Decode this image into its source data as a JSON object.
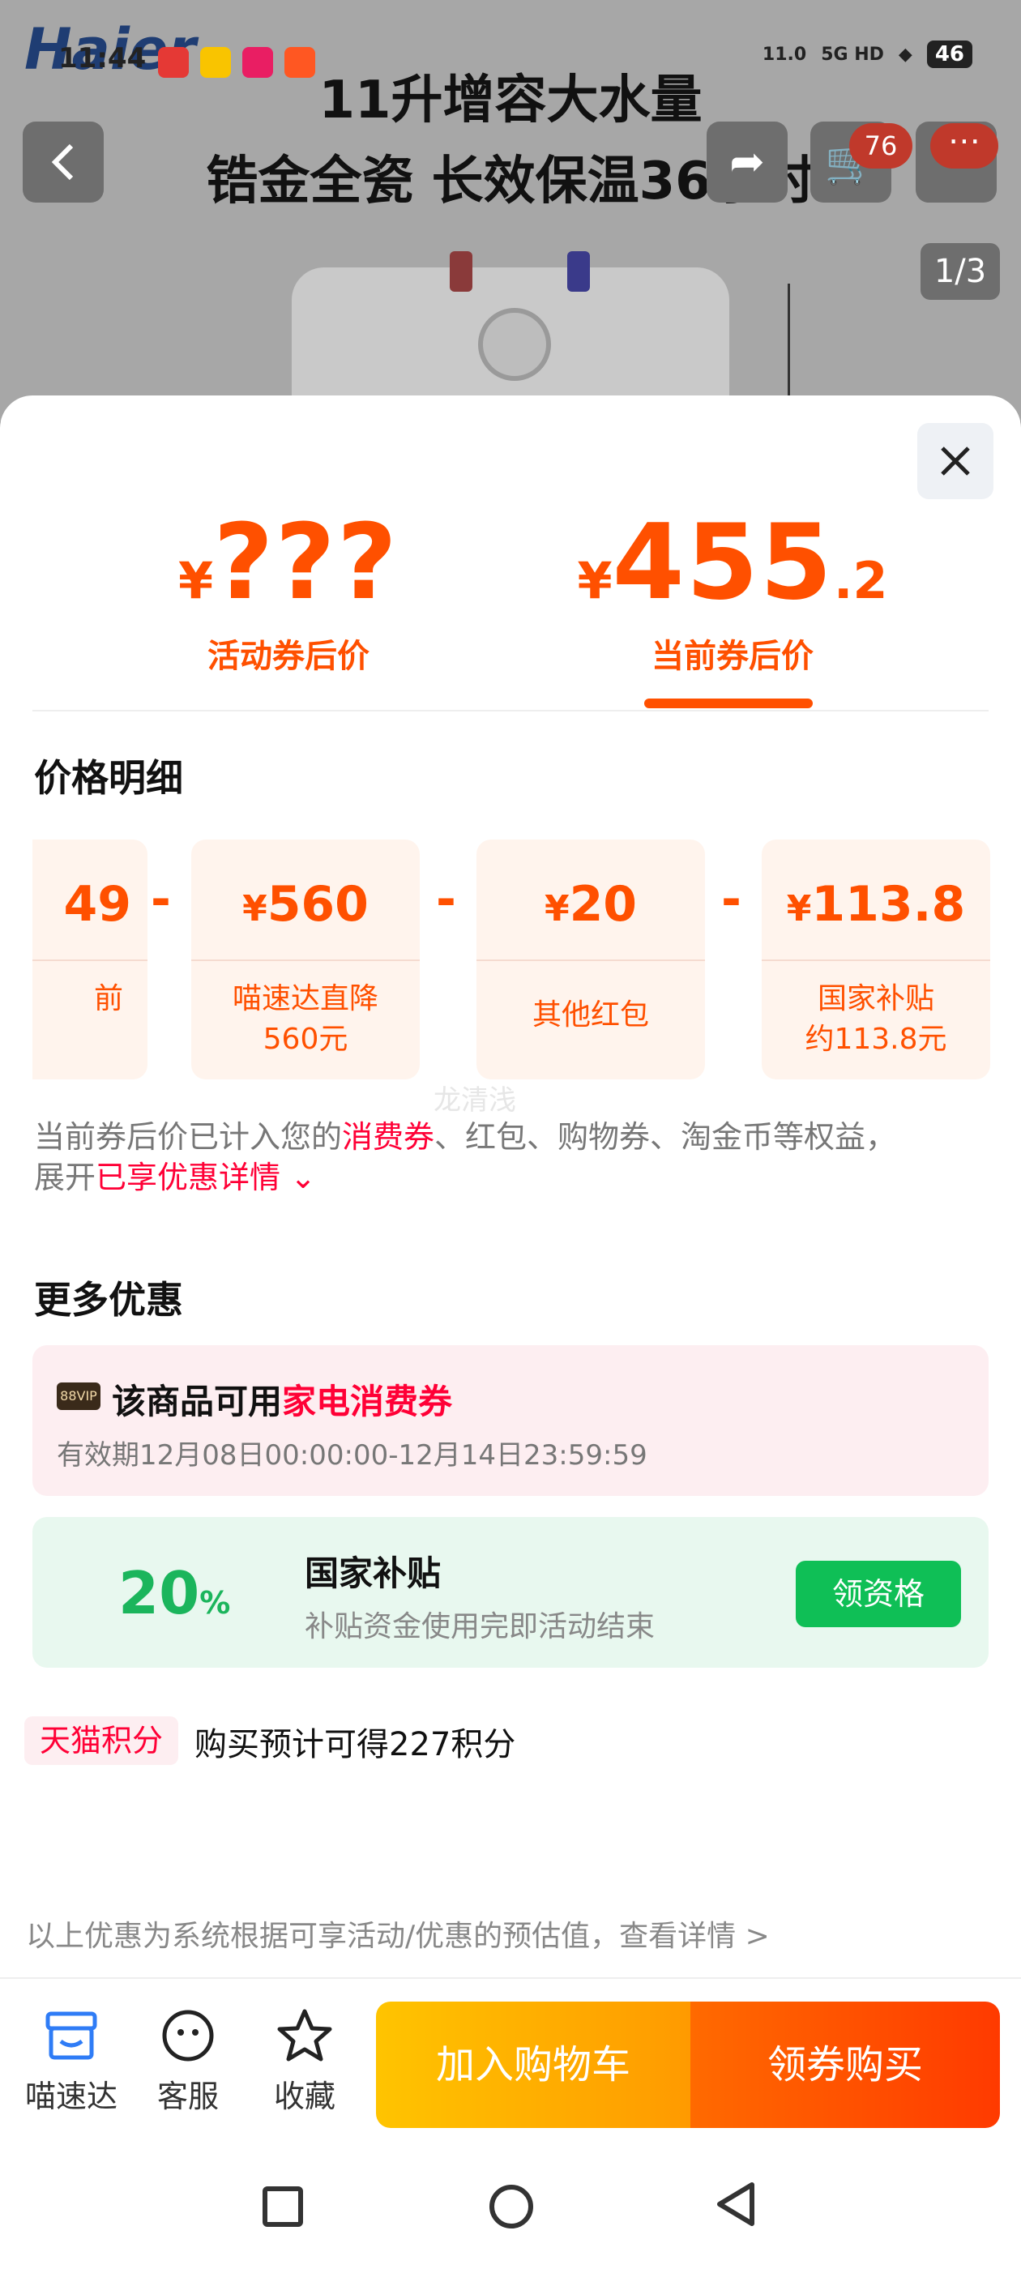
{
  "status_bar": {
    "time": "11:44",
    "speed": "11.0",
    "network": "5G HD",
    "battery": "46"
  },
  "background": {
    "brand": "Haier",
    "title_line1": "11升增容大水量",
    "title_line2": "锆金全瓷 长效保温36小时",
    "cart_badge": "76",
    "image_pager": "1/3"
  },
  "prices": {
    "activity": {
      "currency": "¥",
      "amount": "???",
      "label": "活动券后价"
    },
    "current": {
      "currency": "¥",
      "amount": "455",
      "decimal": ".2",
      "label": "当前券后价"
    }
  },
  "detail": {
    "title": "价格明细",
    "cards": [
      {
        "value": "49",
        "desc": "前"
      },
      {
        "currency": "¥",
        "value": "560",
        "desc_line1": "喵速达直降",
        "desc_line2": "560元"
      },
      {
        "currency": "¥",
        "value": "20",
        "desc": "其他红包"
      },
      {
        "currency": "¥",
        "value": "113.8",
        "desc_line1": "国家补贴",
        "desc_line2": "约113.8元"
      }
    ],
    "operator": "-",
    "note_prefix": "当前券后价已计入您的",
    "note_highlight": "消费券",
    "note_rest": "、红包、购物券、淘金币等权益，",
    "note_line2_prefix": "展开",
    "note_line2_link": "已享优惠详情",
    "watermark": "龙清浅"
  },
  "more": {
    "title": "更多优惠",
    "vip": {
      "tag": "88VIP",
      "text_prefix": "该商品可用",
      "text_highlight": "家电消费券",
      "validity": "有效期12月08日00:00:00-12月14日23:59:59"
    },
    "gov": {
      "percent": "20",
      "percent_sign": "%",
      "title": "国家补贴",
      "subtitle": "补贴资金使用完即活动结束",
      "button": "领资格"
    }
  },
  "points": {
    "tag": "天猫积分",
    "text": "购买预计可得227积分"
  },
  "footer_note": "以上优惠为系统根据可享活动/优惠的预估值，查看详情 >",
  "bottom_bar": {
    "items": [
      {
        "label": "喵速达"
      },
      {
        "label": "客服"
      },
      {
        "label": "收藏"
      }
    ],
    "add_cart": "加入购物车",
    "buy": "领券购买"
  },
  "colors": {
    "accent": "#ff5000",
    "red": "#ff0036",
    "green": "#0fbf56"
  }
}
